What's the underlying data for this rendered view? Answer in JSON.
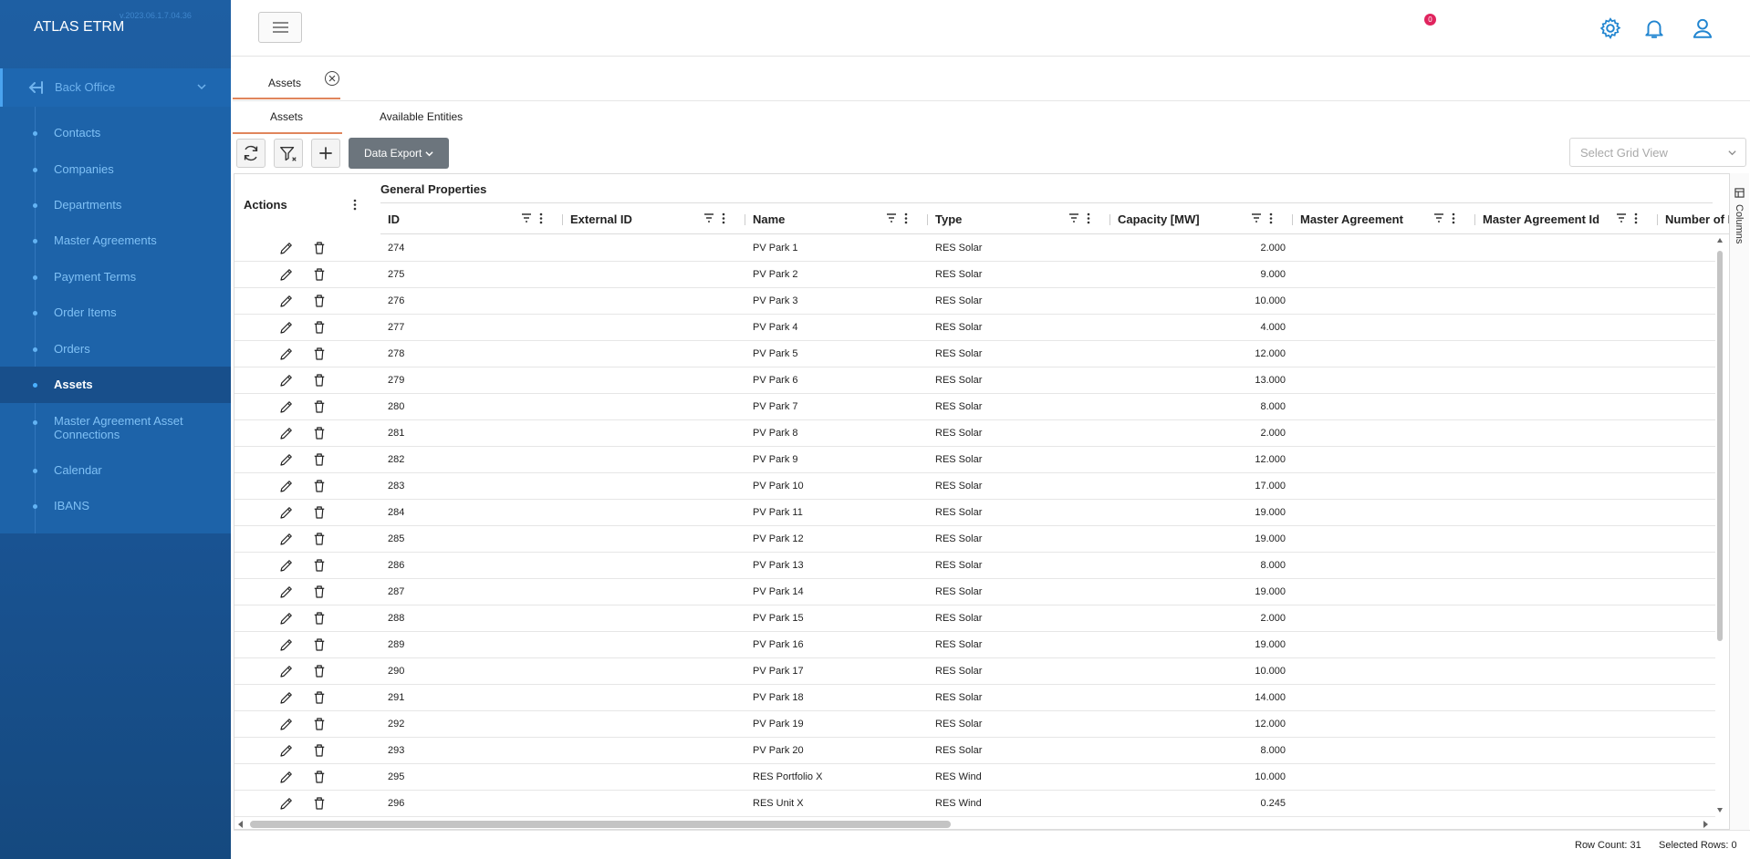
{
  "app": {
    "title": "ATLAS ETRM",
    "version": "v.2023.06.1.7.04.36"
  },
  "sidebar": {
    "section_label": "Back Office",
    "items": [
      {
        "label": "Contacts",
        "active": false
      },
      {
        "label": "Companies",
        "active": false
      },
      {
        "label": "Departments",
        "active": false
      },
      {
        "label": "Master Agreements",
        "active": false
      },
      {
        "label": "Payment Terms",
        "active": false
      },
      {
        "label": "Order Items",
        "active": false
      },
      {
        "label": "Orders",
        "active": false
      },
      {
        "label": "Assets",
        "active": true
      },
      {
        "label": "Master Agreement Asset Connections",
        "active": false
      },
      {
        "label": "Calendar",
        "active": false
      },
      {
        "label": "IBANS",
        "active": false
      }
    ]
  },
  "header": {
    "notification_count": "0",
    "icons": [
      "gear-icon",
      "bell-icon",
      "user-icon"
    ]
  },
  "page_tab": {
    "label": "Assets"
  },
  "sub_tabs": [
    {
      "label": "Assets",
      "active": true
    },
    {
      "label": "Available Entities",
      "active": false
    }
  ],
  "toolbar": {
    "export_label": "Data Export",
    "grid_view_placeholder": "Select Grid View"
  },
  "grid": {
    "actions_label": "Actions",
    "group_label": "General Properties",
    "columns": [
      "ID",
      "External ID",
      "Name",
      "Type",
      "Capacity [MW]",
      "Master Agreement",
      "Master Agreement Id",
      "Number of R"
    ],
    "rows": [
      {
        "id": "274",
        "external_id": "",
        "name": "PV Park 1",
        "type": "RES Solar",
        "capacity": "2.000"
      },
      {
        "id": "275",
        "external_id": "",
        "name": "PV Park 2",
        "type": "RES Solar",
        "capacity": "9.000"
      },
      {
        "id": "276",
        "external_id": "",
        "name": "PV Park 3",
        "type": "RES Solar",
        "capacity": "10.000"
      },
      {
        "id": "277",
        "external_id": "",
        "name": "PV Park 4",
        "type": "RES Solar",
        "capacity": "4.000"
      },
      {
        "id": "278",
        "external_id": "",
        "name": "PV Park 5",
        "type": "RES Solar",
        "capacity": "12.000"
      },
      {
        "id": "279",
        "external_id": "",
        "name": "PV Park 6",
        "type": "RES Solar",
        "capacity": "13.000"
      },
      {
        "id": "280",
        "external_id": "",
        "name": "PV Park 7",
        "type": "RES Solar",
        "capacity": "8.000"
      },
      {
        "id": "281",
        "external_id": "",
        "name": "PV Park 8",
        "type": "RES Solar",
        "capacity": "2.000"
      },
      {
        "id": "282",
        "external_id": "",
        "name": "PV Park 9",
        "type": "RES Solar",
        "capacity": "12.000"
      },
      {
        "id": "283",
        "external_id": "",
        "name": "PV Park 10",
        "type": "RES Solar",
        "capacity": "17.000"
      },
      {
        "id": "284",
        "external_id": "",
        "name": "PV Park 11",
        "type": "RES Solar",
        "capacity": "19.000"
      },
      {
        "id": "285",
        "external_id": "",
        "name": "PV Park 12",
        "type": "RES Solar",
        "capacity": "19.000"
      },
      {
        "id": "286",
        "external_id": "",
        "name": "PV Park 13",
        "type": "RES Solar",
        "capacity": "8.000"
      },
      {
        "id": "287",
        "external_id": "",
        "name": "PV Park 14",
        "type": "RES Solar",
        "capacity": "19.000"
      },
      {
        "id": "288",
        "external_id": "",
        "name": "PV Park 15",
        "type": "RES Solar",
        "capacity": "2.000"
      },
      {
        "id": "289",
        "external_id": "",
        "name": "PV Park 16",
        "type": "RES Solar",
        "capacity": "19.000"
      },
      {
        "id": "290",
        "external_id": "",
        "name": "PV Park 17",
        "type": "RES Solar",
        "capacity": "10.000"
      },
      {
        "id": "291",
        "external_id": "",
        "name": "PV Park 18",
        "type": "RES Solar",
        "capacity": "14.000"
      },
      {
        "id": "292",
        "external_id": "",
        "name": "PV Park 19",
        "type": "RES Solar",
        "capacity": "12.000"
      },
      {
        "id": "293",
        "external_id": "",
        "name": "PV Park 20",
        "type": "RES Solar",
        "capacity": "8.000"
      },
      {
        "id": "295",
        "external_id": "",
        "name": "RES Portfolio X",
        "type": "RES Wind",
        "capacity": "10.000"
      },
      {
        "id": "296",
        "external_id": "",
        "name": "RES Unit X",
        "type": "RES Wind",
        "capacity": "0.245"
      }
    ]
  },
  "columns_panel_label": "Columns",
  "footer": {
    "row_count": "Row Count: 31",
    "selected_rows": "Selected Rows: 0"
  },
  "colors": {
    "accent": "#e0855c",
    "sidebar": "#1a5596",
    "primary": "#2185d0",
    "badge": "#e0245e"
  }
}
